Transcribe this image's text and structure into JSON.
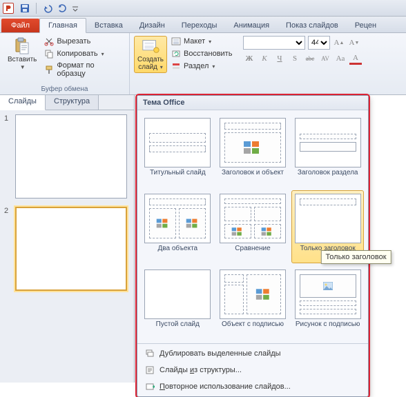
{
  "qat": {
    "save": "save",
    "undo": "undo",
    "redo": "redo"
  },
  "tabs": {
    "file": "Файл",
    "home": "Главная",
    "insert": "Вставка",
    "design": "Дизайн",
    "transitions": "Переходы",
    "animation": "Анимация",
    "slideshow": "Показ слайдов",
    "review": "Рецен"
  },
  "clipboard": {
    "paste": "Вставить",
    "cut": "Вырезать",
    "copy": "Копировать",
    "format_painter": "Формат по образцу",
    "group_label": "Буфер обмена"
  },
  "slides_group": {
    "new_slide_line1": "Создать",
    "new_slide_line2": "слайд",
    "layout": "Макет",
    "reset": "Восстановить",
    "section": "Раздел"
  },
  "font": {
    "size": "44",
    "bold": "Ж",
    "italic": "К",
    "underline": "Ч",
    "shadow": "S",
    "strike": "abc",
    "spacing": "AV",
    "case": "Aa",
    "fontcolor": "A"
  },
  "sidepane": {
    "tab_slides": "Слайды",
    "tab_outline": "Структура",
    "thumb1": "1",
    "thumb2": "2"
  },
  "gallery": {
    "header": "Тема Office",
    "items": [
      {
        "id": "title",
        "label": "Титульный слайд"
      },
      {
        "id": "title-content",
        "label": "Заголовок и объект"
      },
      {
        "id": "section",
        "label": "Заголовок раздела"
      },
      {
        "id": "two-content",
        "label": "Два объекта"
      },
      {
        "id": "comparison",
        "label": "Сравнение"
      },
      {
        "id": "title-only",
        "label": "Только заголовок"
      },
      {
        "id": "blank",
        "label": "Пустой слайд"
      },
      {
        "id": "content-caption",
        "label": "Объект с подписью"
      },
      {
        "id": "picture-caption",
        "label": "Рисунок с подписью"
      }
    ],
    "tooltip": "Только заголовок",
    "foot": {
      "duplicate_pre": "Д",
      "duplicate_post": "ублировать выделенные слайды",
      "outline_pre": "Слайды ",
      "outline_u": "и",
      "outline_post": "з структуры...",
      "reuse_pre": "П",
      "reuse_post": "овторное использование слайдов..."
    }
  }
}
